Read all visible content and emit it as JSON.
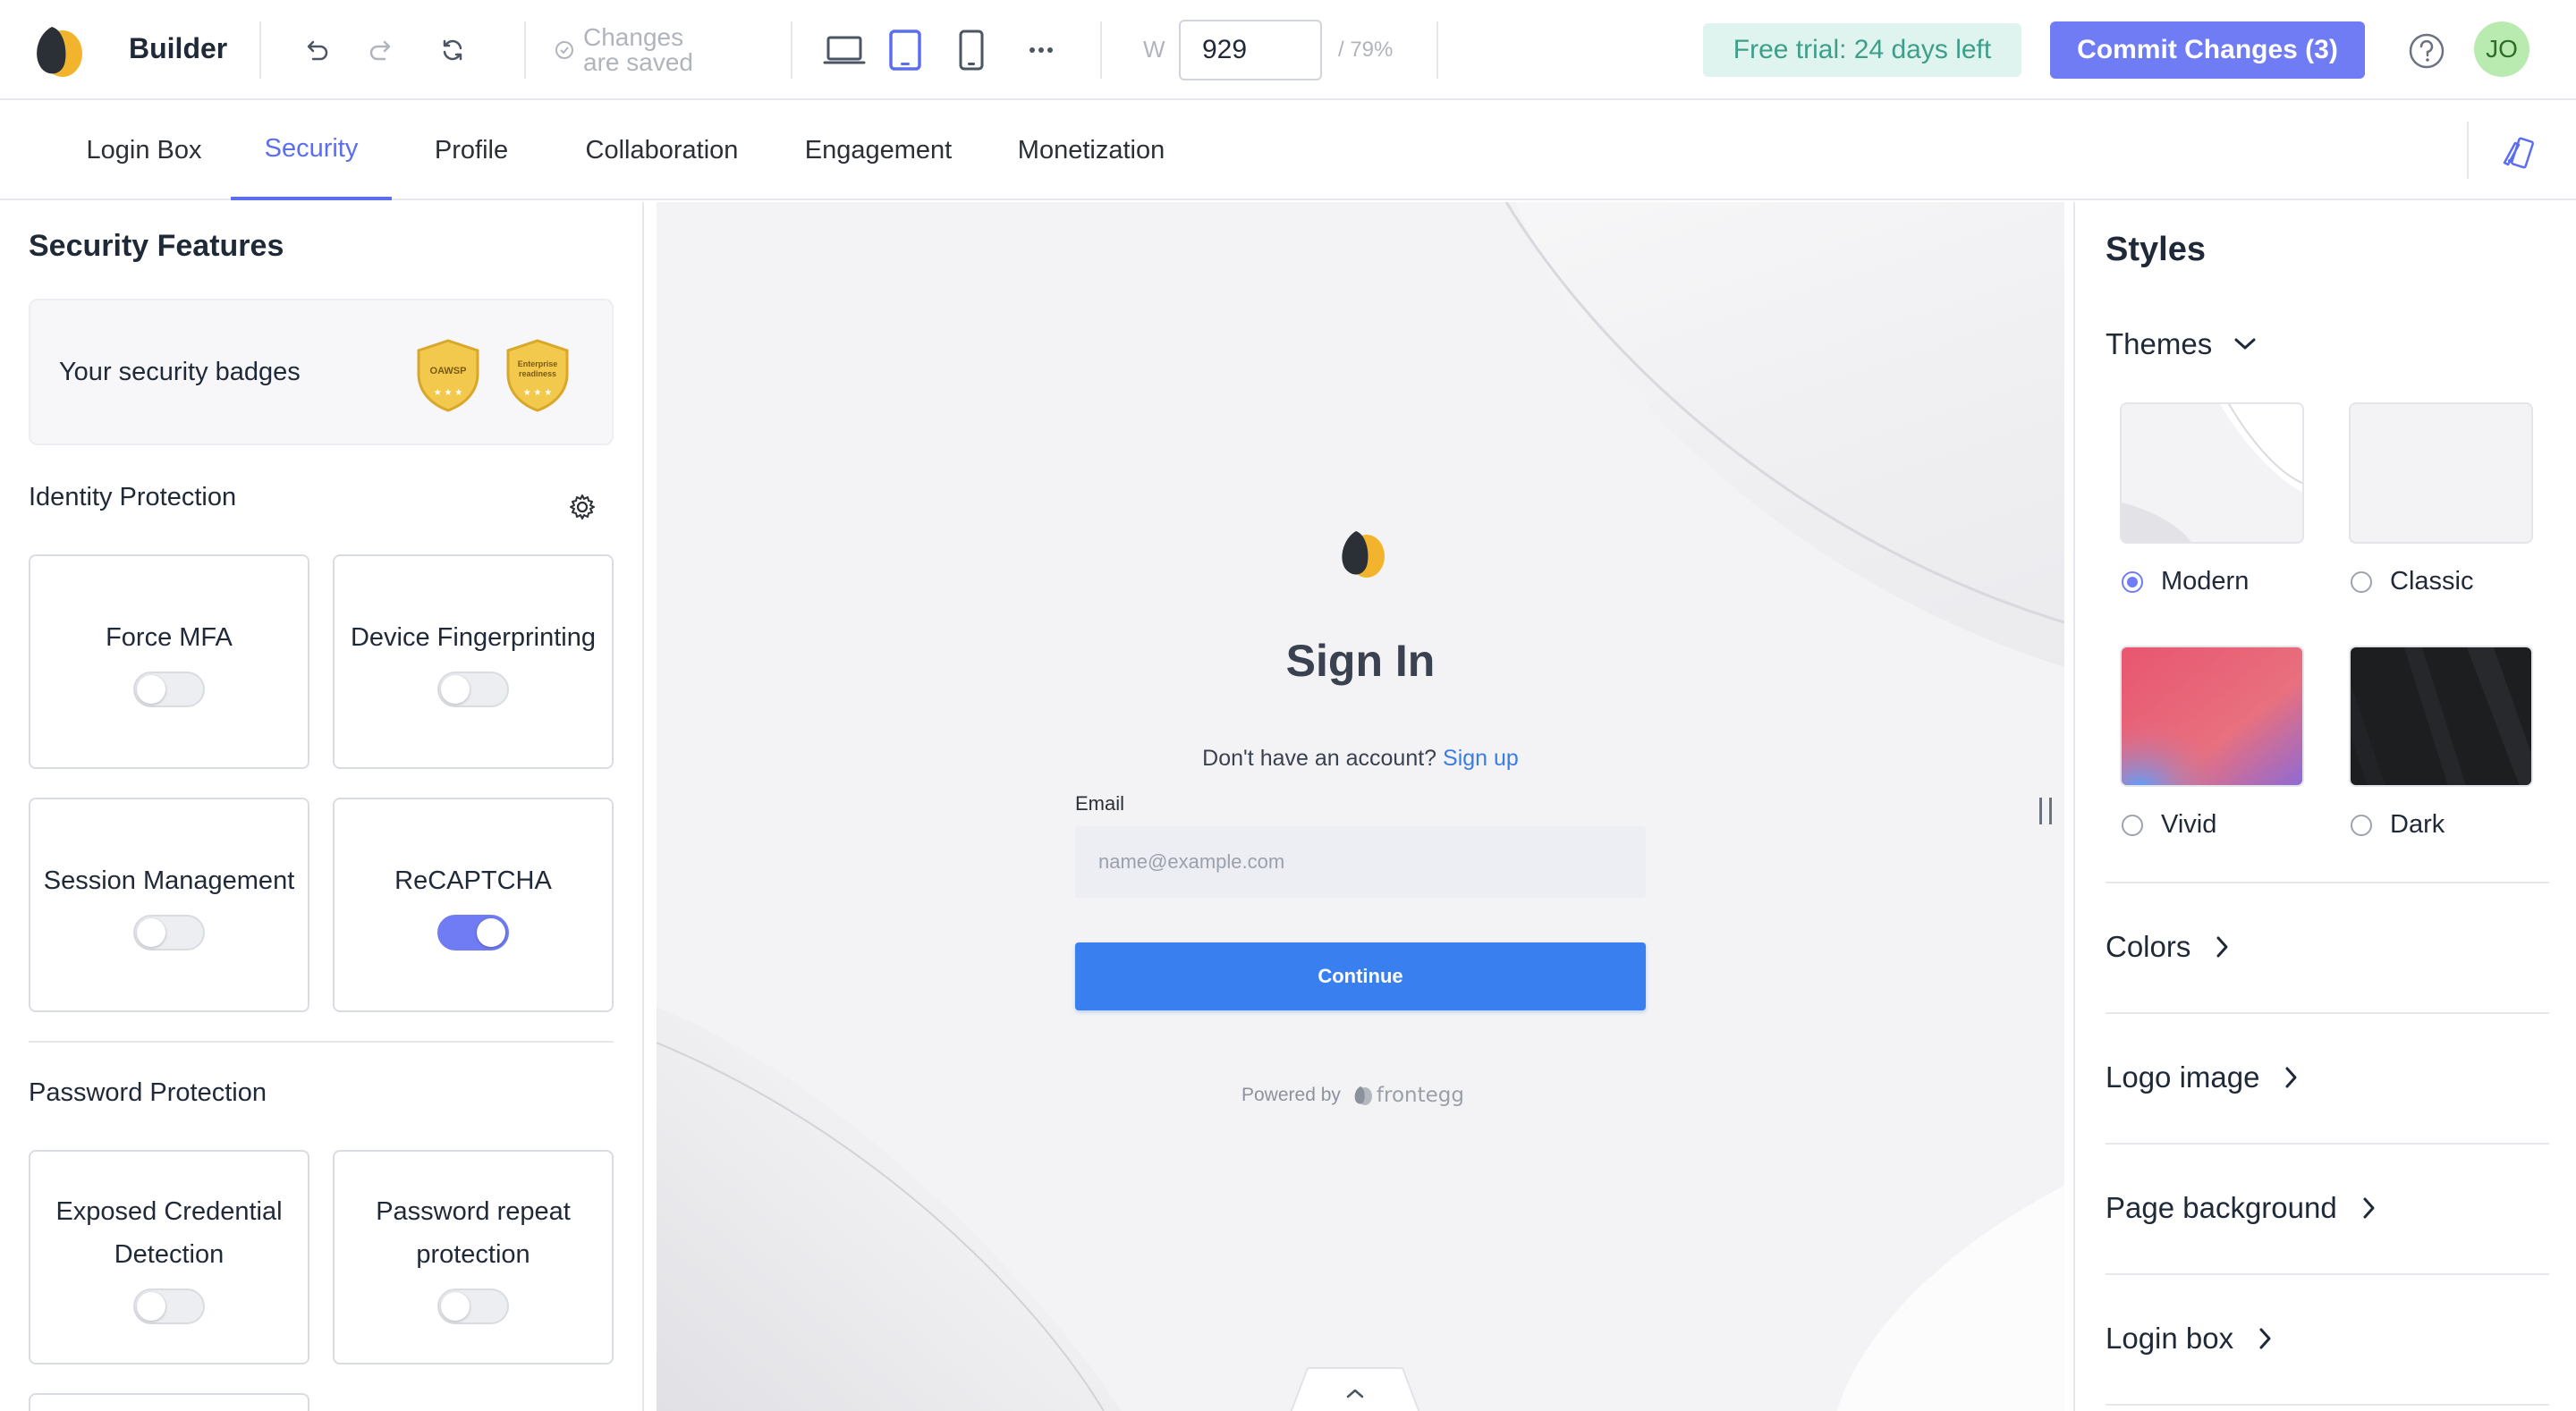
{
  "topbar": {
    "app_title": "Builder",
    "saved_status": "Changes are saved",
    "width_label": "W",
    "width_value": "929",
    "zoom_pct": "/ 79%",
    "trial_text": "Free trial: 24 days left",
    "commit_label": "Commit Changes (3)",
    "avatar_initials": "JO",
    "active_device": "tablet"
  },
  "tabs": [
    {
      "label": "Login Box",
      "active": false
    },
    {
      "label": "Security",
      "active": true
    },
    {
      "label": "Profile",
      "active": false
    },
    {
      "label": "Collaboration",
      "active": false
    },
    {
      "label": "Engagement",
      "active": false
    },
    {
      "label": "Monetization",
      "active": false
    }
  ],
  "security": {
    "title": "Security Features",
    "badges_label": "Your security badges",
    "badges": [
      "OAWSP",
      "Enterprise readiness"
    ],
    "identity": {
      "title": "Identity Protection",
      "features": [
        {
          "name": "Force MFA",
          "enabled": false
        },
        {
          "name": "Device Fingerprinting",
          "enabled": false
        },
        {
          "name": "Session Management",
          "enabled": false
        },
        {
          "name": "ReCAPTCHA",
          "enabled": true
        }
      ]
    },
    "password": {
      "title": "Password Protection",
      "features": [
        {
          "name": "Exposed Credential Detection",
          "enabled": false
        },
        {
          "name": "Password repeat protection",
          "enabled": false
        }
      ]
    }
  },
  "login_preview": {
    "title": "Sign In",
    "signup_prompt": "Don't have an account?",
    "signup_link": "Sign up",
    "email_label": "Email",
    "email_placeholder": "name@example.com",
    "continue_label": "Continue",
    "powered_by": "Powered by",
    "powered_brand": "frontegg"
  },
  "styles": {
    "title": "Styles",
    "themes_label": "Themes",
    "themes": [
      {
        "name": "Modern",
        "selected": true
      },
      {
        "name": "Classic",
        "selected": false
      },
      {
        "name": "Vivid",
        "selected": false
      },
      {
        "name": "Dark",
        "selected": false
      }
    ],
    "sections": [
      "Colors",
      "Logo image",
      "Page background",
      "Login box"
    ]
  },
  "colors": {
    "accent": "#6f7cf3",
    "primary_button": "#3a7ff0",
    "trial_bg": "#dff3ef",
    "avatar_bg": "#b9ebb0",
    "badge_gold": "#f2c94c"
  }
}
